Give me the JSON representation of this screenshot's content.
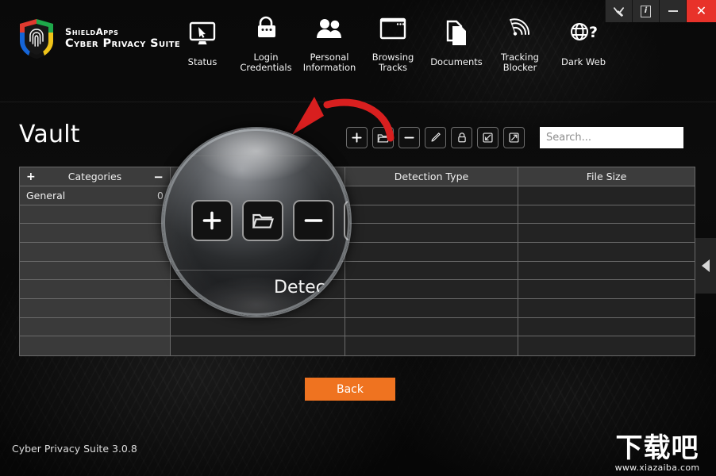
{
  "titlebar": {
    "buttons": [
      {
        "name": "tools",
        "glyph": "✂"
      },
      {
        "name": "info",
        "glyph": "i"
      },
      {
        "name": "minimize",
        "glyph": "–"
      },
      {
        "name": "close",
        "glyph": "✕"
      }
    ]
  },
  "brand": {
    "line1": "ShieldApps",
    "line2": "Cyber Privacy Suite"
  },
  "nav": {
    "items": [
      {
        "label": "Status",
        "icon": "monitor-icon"
      },
      {
        "label": "Login\nCredentials",
        "icon": "padlock-password-icon"
      },
      {
        "label": "Personal\nInformation",
        "icon": "people-icon"
      },
      {
        "label": "Browsing\nTracks",
        "icon": "browser-window-icon"
      },
      {
        "label": "Documents",
        "icon": "documents-icon"
      },
      {
        "label": "Tracking\nBlocker",
        "icon": "signal-waves-icon"
      },
      {
        "label": "Dark Web",
        "icon": "globe-question-icon"
      }
    ]
  },
  "page": {
    "title": "Vault"
  },
  "toolbar": {
    "buttons": [
      {
        "name": "add",
        "glyph": "+",
        "tip": "Add"
      },
      {
        "name": "add-folder",
        "glyph": "folder",
        "tip": "Add Folder"
      },
      {
        "name": "remove",
        "glyph": "−",
        "tip": "Remove"
      },
      {
        "name": "edit",
        "glyph": "pencil",
        "tip": "Edit"
      },
      {
        "name": "lock",
        "glyph": "lock",
        "tip": "Lock"
      },
      {
        "name": "import",
        "glyph": "import",
        "tip": "Import"
      },
      {
        "name": "export",
        "glyph": "export",
        "tip": "Export"
      }
    ]
  },
  "search": {
    "placeholder": "Search...",
    "value": ""
  },
  "table": {
    "headers": {
      "add_symbol": "+",
      "remove_symbol": "−",
      "categories": "Categories",
      "col2": "",
      "detection_type": "Detection Type",
      "file_size": "File Size"
    },
    "rows": [
      {
        "category": "General",
        "count": "0",
        "col2": "",
        "detection_type": "",
        "file_size": ""
      },
      {
        "category": "",
        "count": "",
        "col2": "",
        "detection_type": "",
        "file_size": ""
      },
      {
        "category": "",
        "count": "",
        "col2": "",
        "detection_type": "",
        "file_size": ""
      },
      {
        "category": "",
        "count": "",
        "col2": "",
        "detection_type": "",
        "file_size": ""
      },
      {
        "category": "",
        "count": "",
        "col2": "",
        "detection_type": "",
        "file_size": ""
      },
      {
        "category": "",
        "count": "",
        "col2": "",
        "detection_type": "",
        "file_size": ""
      },
      {
        "category": "",
        "count": "",
        "col2": "",
        "detection_type": "",
        "file_size": ""
      },
      {
        "category": "",
        "count": "",
        "col2": "",
        "detection_type": "",
        "file_size": ""
      },
      {
        "category": "",
        "count": "",
        "col2": "",
        "detection_type": "",
        "file_size": ""
      }
    ]
  },
  "footer": {
    "back_label": "Back",
    "version": "Cyber Privacy Suite 3.0.8"
  },
  "magnifier": {
    "buttons": [
      "+",
      "folder",
      "−"
    ],
    "clipped_text": "Detec"
  },
  "watermark": {
    "chinese": "下载吧",
    "url": "www.xiazaiba.com"
  },
  "colors": {
    "accent": "#ef7320",
    "close": "#e8322a",
    "annotation_arrow": "#d81f1f",
    "background": "#0a0a0a",
    "table_header": "#3c3c3c"
  }
}
